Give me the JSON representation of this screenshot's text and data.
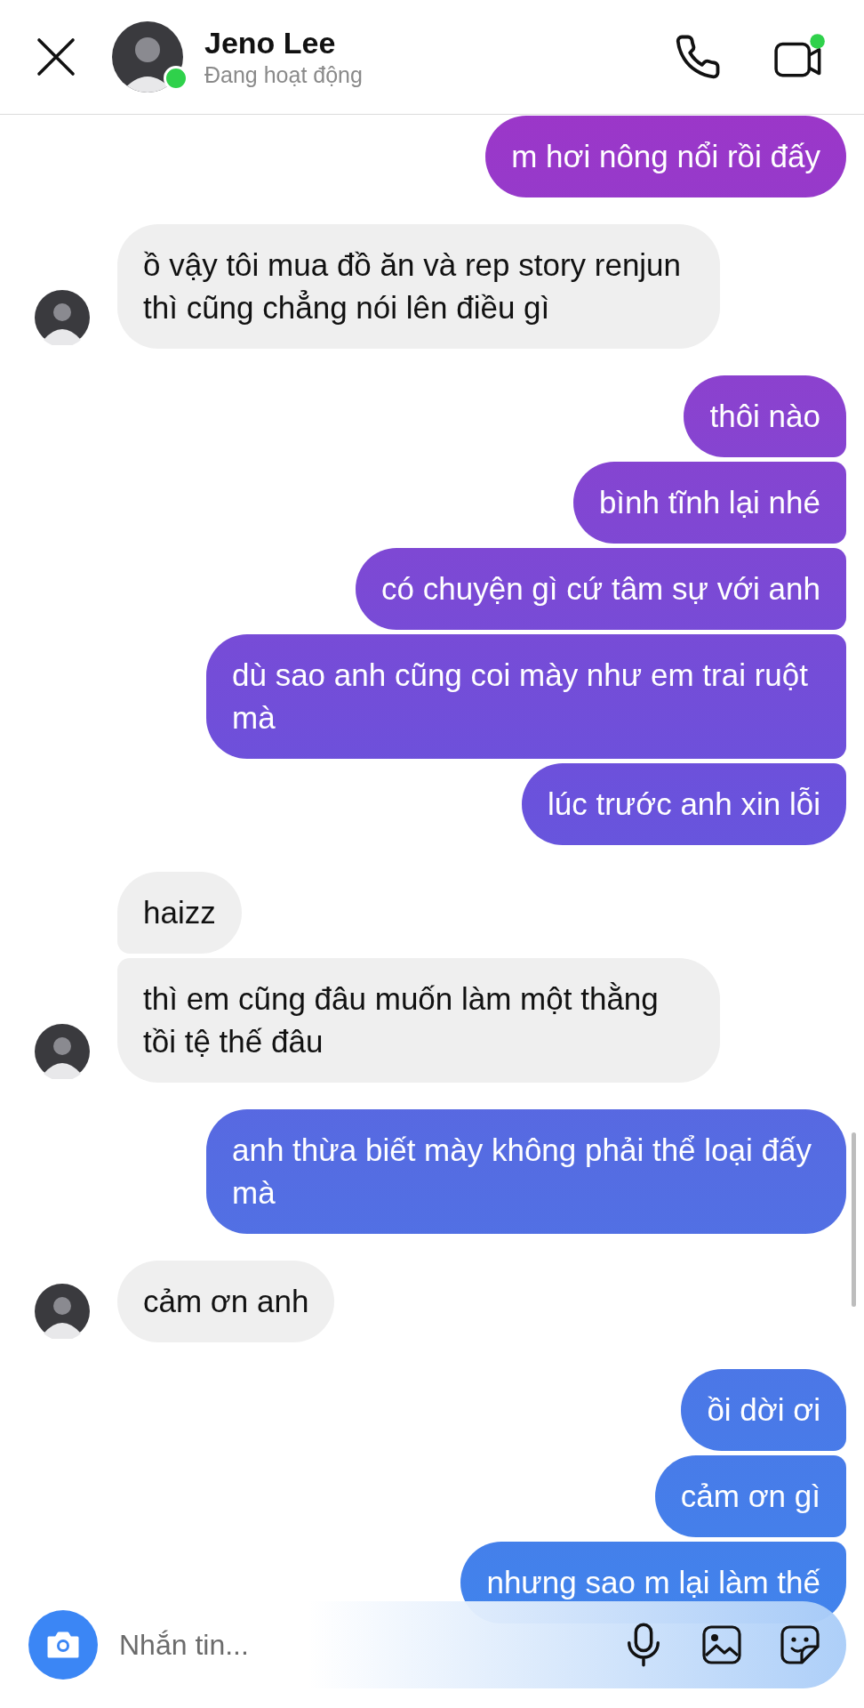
{
  "header": {
    "name": "Jeno Lee",
    "status": "Đang hoạt động",
    "online": true
  },
  "groups": [
    {
      "kind": "me",
      "messages": [
        "m hơi nông nổi rồi đấy"
      ]
    },
    {
      "kind": "them",
      "messages": [
        "ồ vậy tôi mua đồ ăn và rep story renjun thì cũng chẳng nói lên điều gì"
      ]
    },
    {
      "kind": "me",
      "messages": [
        "thôi nào",
        "bình tĩnh lại nhé",
        "có chuyện gì cứ tâm sự với anh",
        "dù sao anh cũng coi mày như em trai ruột mà",
        "lúc trước anh xin lỗi"
      ]
    },
    {
      "kind": "them",
      "messages": [
        "haizz",
        "thì em cũng đâu muốn làm một thằng tồi tệ thế đâu"
      ]
    },
    {
      "kind": "me",
      "messages": [
        "anh thừa biết mày không phải thể loại đấy mà"
      ]
    },
    {
      "kind": "them",
      "messages": [
        "cảm ơn anh"
      ]
    },
    {
      "kind": "me",
      "messages": [
        "ồi dời ơi",
        "cảm ơn gì",
        "nhưng sao m lại làm thế"
      ]
    }
  ],
  "composer": {
    "placeholder": "Nhắn tin..."
  }
}
